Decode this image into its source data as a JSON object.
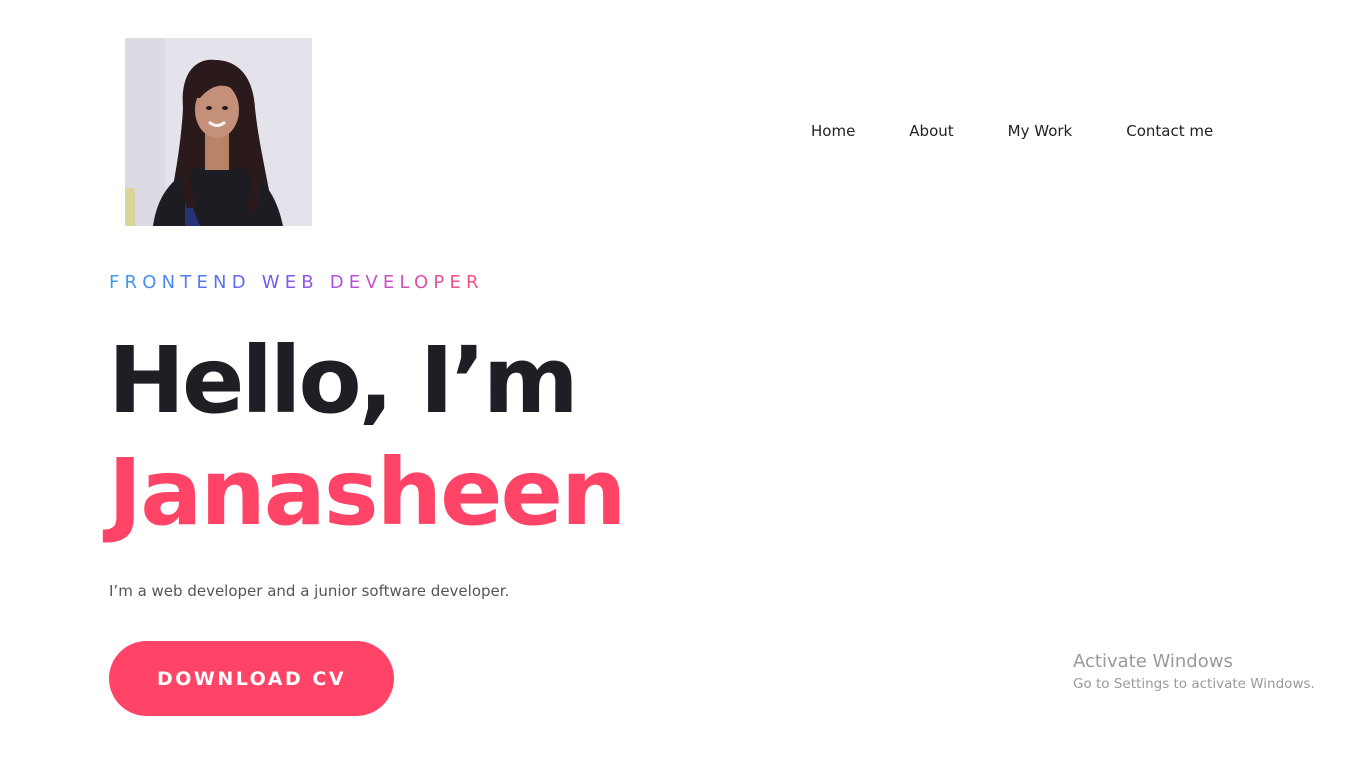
{
  "profile": {
    "photo_alt": "profile photo"
  },
  "nav": {
    "items": [
      {
        "label": "Home"
      },
      {
        "label": "About"
      },
      {
        "label": "My Work"
      },
      {
        "label": "Contact me"
      }
    ]
  },
  "hero": {
    "subtitle": "FRONTEND WEB DEVELOPER",
    "greeting": "Hello, I’m",
    "name": "Janasheen",
    "tagline": "I’m a web developer and a junior software developer.",
    "cta_label": "DOWNLOAD CV"
  },
  "watermark": {
    "title": "Activate Windows",
    "subtitle": "Go to Settings to activate Windows."
  },
  "colors": {
    "accent": "#ff4467",
    "heading": "#1e1e24",
    "gradient_start": "#3b9cf0",
    "gradient_end": "#ff4f79"
  }
}
